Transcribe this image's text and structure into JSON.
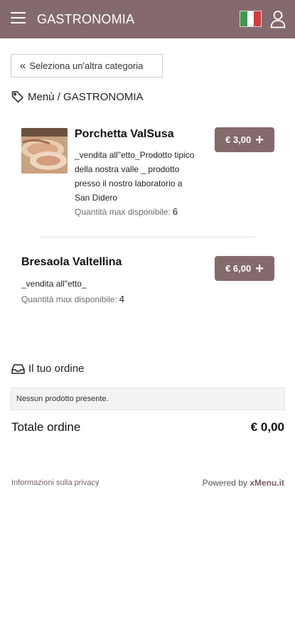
{
  "header": {
    "title": "GASTRONOMIA",
    "menu_icon": "hamburger-menu-icon",
    "language_flag": "italy-flag-icon",
    "user_icon": "user-icon",
    "brand_color": "#856a6d"
  },
  "navigation": {
    "back_label": "Seleziona un'altra categoria",
    "back_icon": "double-chevron-left-icon",
    "breadcrumb_icon": "tag-icon",
    "breadcrumb": "Menù / GASTRONOMIA"
  },
  "products": [
    {
      "name": "Porchetta ValSusa",
      "description_lines": [
        "_vendita all\"etto_Prodotto tipico",
        "della nostra valle _ prodotto",
        "presso il nostro laboratorio a",
        "San Didero"
      ],
      "qty_label": "Quantità max disponibile:",
      "qty_value": "6",
      "price": "€ 3,00",
      "add_icon": "plus-icon"
    },
    {
      "name": "Bresaola Valtellina",
      "description_lines": [
        "_vendita all\"etto_"
      ],
      "qty_label": "Quantità max disponibile:",
      "qty_value": "4",
      "price": "€ 6,00",
      "add_icon": "plus-icon"
    }
  ],
  "order": {
    "icon": "tray-icon",
    "title": "Il tuo ordine",
    "empty_message": "Nessun prodotto presente.",
    "total_label": "Totale ordine",
    "total_value": "€ 0,00"
  },
  "footer": {
    "privacy_link": "Informazioni sulla privacy",
    "powered_prefix": "Powered by",
    "powered_brand": "xMenu.it"
  }
}
